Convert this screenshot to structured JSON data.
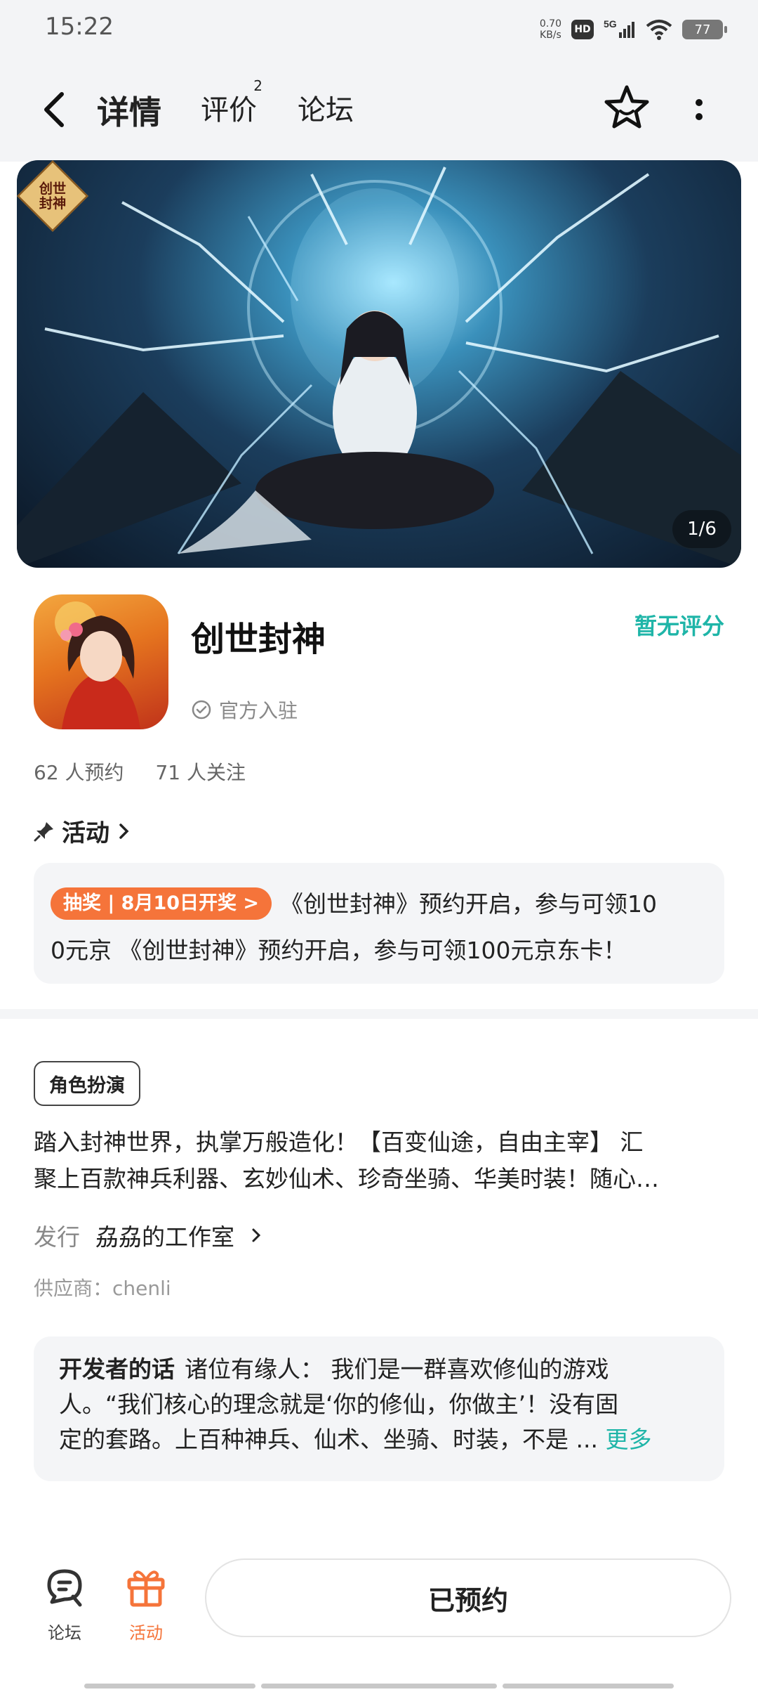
{
  "status_bar": {
    "time": "15:22",
    "net_speed_value": "0.70",
    "net_speed_unit": "KB/s",
    "hd": "HD",
    "network": "5G",
    "battery": "77"
  },
  "nav": {
    "tabs": [
      {
        "label": "详情",
        "active": true
      },
      {
        "label": "评价",
        "badge": "2"
      },
      {
        "label": "论坛"
      }
    ],
    "icons": [
      "back-arrow-icon",
      "star-icon",
      "more-vertical-icon"
    ]
  },
  "banner": {
    "logo_text_line1": "创世",
    "logo_text_line2": "封神",
    "counter": "1/6"
  },
  "app": {
    "name": "创世封神",
    "official": "官方入驻",
    "rating": "暂无评分",
    "reservations": "62 人预约",
    "followers": "71 人关注"
  },
  "activity": {
    "heading": "活动",
    "tag": "抽奖 | 8月10日开奖 >",
    "text_line1": "《创世封神》预约开启，参与可领10",
    "text_line2": "0元京 《创世封神》预约开启，参与可领100元京东卡！"
  },
  "detail": {
    "genre": "角色扮演",
    "desc_line1": "踏入封神世界，执掌万般造化！【百变仙途，自由主宰】 汇",
    "desc_line2": "聚上百款神兵利器、玄妙仙术、珍奇坐骑、华美时装！随心…",
    "publisher_label": "发行",
    "publisher_name": "劦劦的工作室",
    "supplier": "供应商：chenli"
  },
  "developer": {
    "title": "开发者的话",
    "line1": "诸位有缘人： 我们是一群喜欢修仙的游戏",
    "line2": "人。“我们核心的理念就是‘你的修仙，你做主’！没有固",
    "line3": "定的套路。上百种神兵、仙术、坐骑、时装，不是 ...",
    "more": "更多"
  },
  "bottom": {
    "forum": "论坛",
    "activity": "活动",
    "reserve": "已预约"
  },
  "colors": {
    "accent": "#26c6c0",
    "orange": "#f5743a",
    "background_gray": "#f4f5f7"
  }
}
